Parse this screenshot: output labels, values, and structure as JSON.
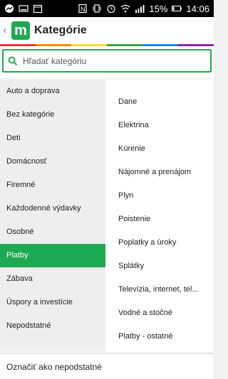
{
  "status_bar": {
    "signal_text": "ıııl ",
    "battery": "15%",
    "time": "14:06"
  },
  "app": {
    "title": "Kategórie",
    "logo_letter": "m"
  },
  "search": {
    "placeholder": "Hľadať kategóriu"
  },
  "categories": [
    {
      "label": "Auto a doprava"
    },
    {
      "label": "Bez kategórie"
    },
    {
      "label": "Deti"
    },
    {
      "label": "Domácnosť"
    },
    {
      "label": "Firemné"
    },
    {
      "label": "Každodenné výdavky"
    },
    {
      "label": "Osobné"
    },
    {
      "label": "Platby"
    },
    {
      "label": "Zábava"
    },
    {
      "label": "Úspory a investície"
    },
    {
      "label": "Nepodstatné"
    }
  ],
  "selected_category": "Platby",
  "subcategories": [
    {
      "label": "Dane"
    },
    {
      "label": "Elektrina"
    },
    {
      "label": "Kúrenie"
    },
    {
      "label": "Nájomné a prenájom"
    },
    {
      "label": "Plyn"
    },
    {
      "label": "Poistenie"
    },
    {
      "label": "Poplatky a úroky"
    },
    {
      "label": "Splátky"
    },
    {
      "label": "Televízia, internet, tel..."
    },
    {
      "label": "Vodné a stočné"
    },
    {
      "label": "Platby - ostatné"
    }
  ],
  "bottom_action": "Označiť ako nepodstatné",
  "colors": {
    "accent": "#1eaa52",
    "rainbow": [
      "#e53935",
      "#fb8c00",
      "#fdd835",
      "#43a047",
      "#1e88e5",
      "#8e24aa"
    ]
  }
}
